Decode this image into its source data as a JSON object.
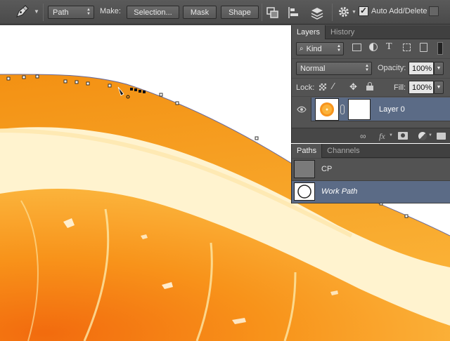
{
  "options_bar": {
    "mode_select": "Path",
    "make_label": "Make:",
    "selection_button": "Selection...",
    "mask_button": "Mask",
    "shape_button": "Shape",
    "auto_add_delete_label": "Auto Add/Delete",
    "auto_add_delete_checked": true
  },
  "layers_panel": {
    "tabs": [
      "Layers",
      "History"
    ],
    "active_tab": "Layers",
    "filter_select": "Kind",
    "blend_mode": "Normal",
    "opacity_label": "Opacity:",
    "opacity_value": "100%",
    "lock_label": "Lock:",
    "fill_label": "Fill:",
    "fill_value": "100%",
    "layers": [
      {
        "name": "Layer 0",
        "visible": true,
        "selected": true
      }
    ],
    "footer_icons": [
      "link-icon",
      "fx-icon",
      "mask-icon",
      "adjustment-icon",
      "folder-icon"
    ]
  },
  "paths_panel": {
    "tabs": [
      "Paths",
      "Channels"
    ],
    "active_tab": "Paths",
    "paths": [
      {
        "name": "CP",
        "selected": false
      },
      {
        "name": "Work Path",
        "selected": true
      }
    ]
  },
  "colors": {
    "selection": "#5b6b86",
    "orange": "#f7941d",
    "pith": "#fff4cf"
  }
}
